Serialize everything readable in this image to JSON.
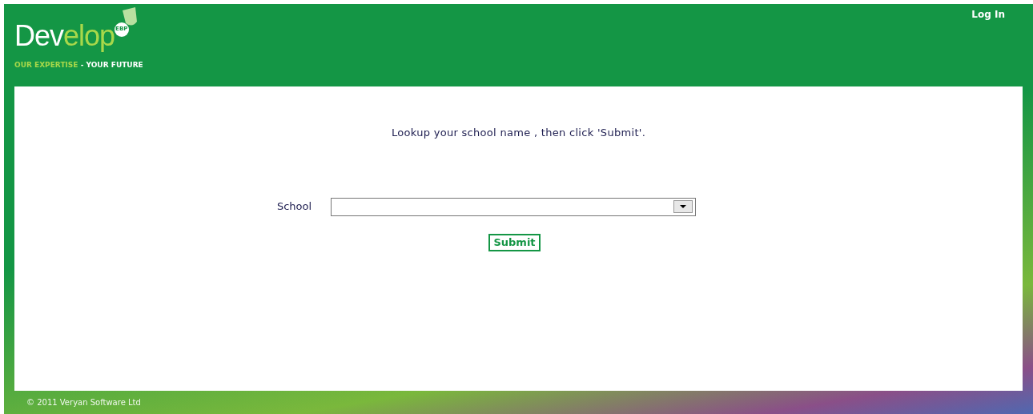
{
  "header": {
    "logo": {
      "word_start": "Dev",
      "word_end": "elop",
      "badge": "EBP"
    },
    "tagline": {
      "first": "OUR EXPERTISE",
      "second": "- YOUR FUTURE"
    },
    "login_link": "Log In"
  },
  "form": {
    "instruction": "Lookup your school name , then click 'Submit'.",
    "field_label": "School",
    "submit": "Submit"
  },
  "footer": {
    "copyright": "© 2011 Veryan Software Ltd"
  }
}
